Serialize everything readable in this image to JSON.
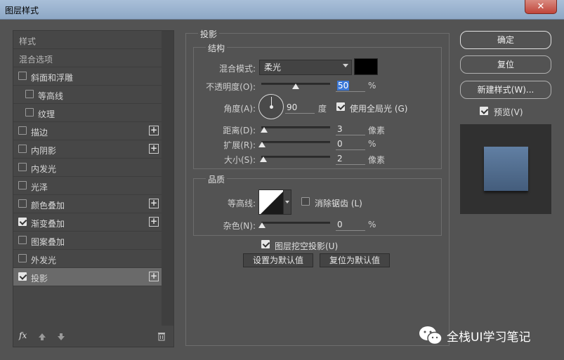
{
  "window": {
    "title": "图层样式",
    "close_glyph": "✕"
  },
  "styles_list": {
    "header1": "样式",
    "header2": "混合选项",
    "items": [
      {
        "label": "斜面和浮雕",
        "checked": false,
        "has_plus": false,
        "indent": 0
      },
      {
        "label": "等高线",
        "checked": false,
        "has_plus": false,
        "indent": 1
      },
      {
        "label": "纹理",
        "checked": false,
        "has_plus": false,
        "indent": 1
      },
      {
        "label": "描边",
        "checked": false,
        "has_plus": true,
        "indent": 0
      },
      {
        "label": "内阴影",
        "checked": false,
        "has_plus": true,
        "indent": 0
      },
      {
        "label": "内发光",
        "checked": false,
        "has_plus": false,
        "indent": 0
      },
      {
        "label": "光泽",
        "checked": false,
        "has_plus": false,
        "indent": 0
      },
      {
        "label": "颜色叠加",
        "checked": false,
        "has_plus": true,
        "indent": 0
      },
      {
        "label": "渐变叠加",
        "checked": true,
        "has_plus": true,
        "indent": 0
      },
      {
        "label": "图案叠加",
        "checked": false,
        "has_plus": false,
        "indent": 0
      },
      {
        "label": "外发光",
        "checked": false,
        "has_plus": false,
        "indent": 0
      },
      {
        "label": "投影",
        "checked": true,
        "has_plus": true,
        "indent": 0,
        "selected": true
      }
    ],
    "plus_glyph": "+",
    "fx_label": "fx"
  },
  "drop_shadow": {
    "section_title": "投影",
    "structure": {
      "title": "结构",
      "blend_mode_label": "混合模式:",
      "blend_mode_value": "柔光",
      "blend_color": "#000000",
      "opacity_label": "不透明度(O):",
      "opacity_value": "50",
      "opacity_unit": "%",
      "angle_label": "角度(A):",
      "angle_value": "90",
      "angle_unit": "度",
      "global_light_label": "使用全局光 (G)",
      "global_light_checked": true,
      "distance_label": "距离(D):",
      "distance_value": "3",
      "distance_unit": "像素",
      "spread_label": "扩展(R):",
      "spread_value": "0",
      "spread_unit": "%",
      "size_label": "大小(S):",
      "size_value": "2",
      "size_unit": "像素"
    },
    "quality": {
      "title": "品质",
      "contour_label": "等高线:",
      "antialias_label": "消除锯齿 (L)",
      "antialias_checked": false,
      "noise_label": "杂色(N):",
      "noise_value": "0",
      "noise_unit": "%"
    },
    "knockout_label": "图层挖空投影(U)",
    "knockout_checked": true,
    "make_default": "设置为默认值",
    "reset_default": "复位为默认值"
  },
  "right_buttons": {
    "ok": "确定",
    "reset": "复位",
    "new_style": "新建样式(W)...",
    "preview_label": "预览(V)",
    "preview_checked": true
  },
  "watermark": {
    "text": "全栈UI学习笔记"
  },
  "colors": {
    "preview_top": "#617fa3",
    "preview_bottom": "#445d7c",
    "selection": "#3b78d8"
  }
}
